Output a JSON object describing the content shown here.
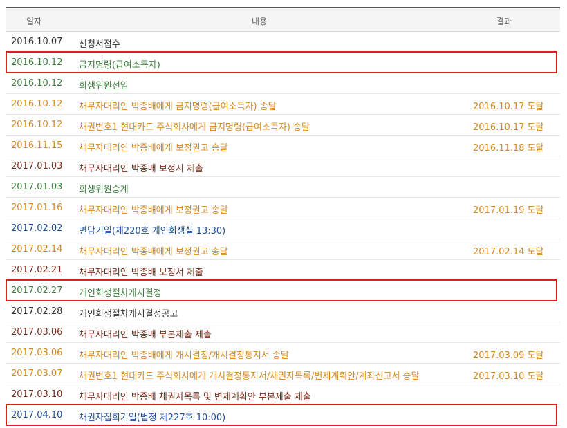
{
  "header": {
    "date": "일자",
    "content": "내용",
    "result": "결과"
  },
  "rows": [
    {
      "date": "2016.10.07",
      "content": "신청서접수",
      "result": "",
      "color": "gray"
    },
    {
      "date": "2016.10.12",
      "content": "금지명령(급여소득자)",
      "result": "",
      "color": "green"
    },
    {
      "date": "2016.10.12",
      "content": "회생위원선임",
      "result": "",
      "color": "green"
    },
    {
      "date": "2016.10.12",
      "content": "채무자대리인 박종배에게 금지명령(급여소득자) 송달",
      "result": "2016.10.17 도달",
      "color": "orange"
    },
    {
      "date": "2016.10.12",
      "content": "채권번호1 현대카드 주식회사에게 금지명령(급여소득자) 송달",
      "result": "2016.10.17 도달",
      "color": "orange"
    },
    {
      "date": "2016.11.15",
      "content": "채무자대리인 박종배에게 보정권고 송달",
      "result": "2016.11.18 도달",
      "color": "orange"
    },
    {
      "date": "2017.01.03",
      "content": "채무자대리인 박종배 보정서 제출",
      "result": "",
      "color": "maroon"
    },
    {
      "date": "2017.01.03",
      "content": "회생위원승계",
      "result": "",
      "color": "green"
    },
    {
      "date": "2017.01.16",
      "content": "채무자대리인 박종배에게 보정권고 송달",
      "result": "2017.01.19 도달",
      "color": "orange"
    },
    {
      "date": "2017.02.02",
      "content": "면담기일(제220호 개인회생실 13:30)",
      "result": "",
      "color": "blue"
    },
    {
      "date": "2017.02.14",
      "content": "채무자대리인 박종배에게 보정권고 송달",
      "result": "2017.02.14 도달",
      "color": "orange"
    },
    {
      "date": "2017.02.21",
      "content": "채무자대리인 박종배 보정서 제출",
      "result": "",
      "color": "maroon"
    },
    {
      "date": "2017.02.27",
      "content": "개인회생절차개시결정",
      "result": "",
      "color": "green"
    },
    {
      "date": "2017.02.28",
      "content": "개인회생절차개시결정공고",
      "result": "",
      "color": "gray"
    },
    {
      "date": "2017.03.06",
      "content": "채무자대리인 박종배 부본제출 제출",
      "result": "",
      "color": "maroon"
    },
    {
      "date": "2017.03.06",
      "content": "채무자대리인 박종배에게 개시결정/개시결정통지서 송달",
      "result": "2017.03.09 도달",
      "color": "orange"
    },
    {
      "date": "2017.03.07",
      "content": "채권번호1 현대카드 주식회사에게 개시결정통지서/채권자목록/변제계획안/계좌신고서 송달",
      "result": "2017.03.10 도달",
      "color": "orange"
    },
    {
      "date": "2017.03.10",
      "content": "채무자대리인 박종배 채권자목록 및 변제계획안 부본제출 제출",
      "result": "",
      "color": "maroon"
    },
    {
      "date": "2017.04.10",
      "content": "채권자집회기일(법정 제227호 10:00)",
      "result": "",
      "color": "blue"
    }
  ],
  "highlighted_rows": [
    1,
    12,
    18
  ],
  "highlight_color": "#e02020"
}
